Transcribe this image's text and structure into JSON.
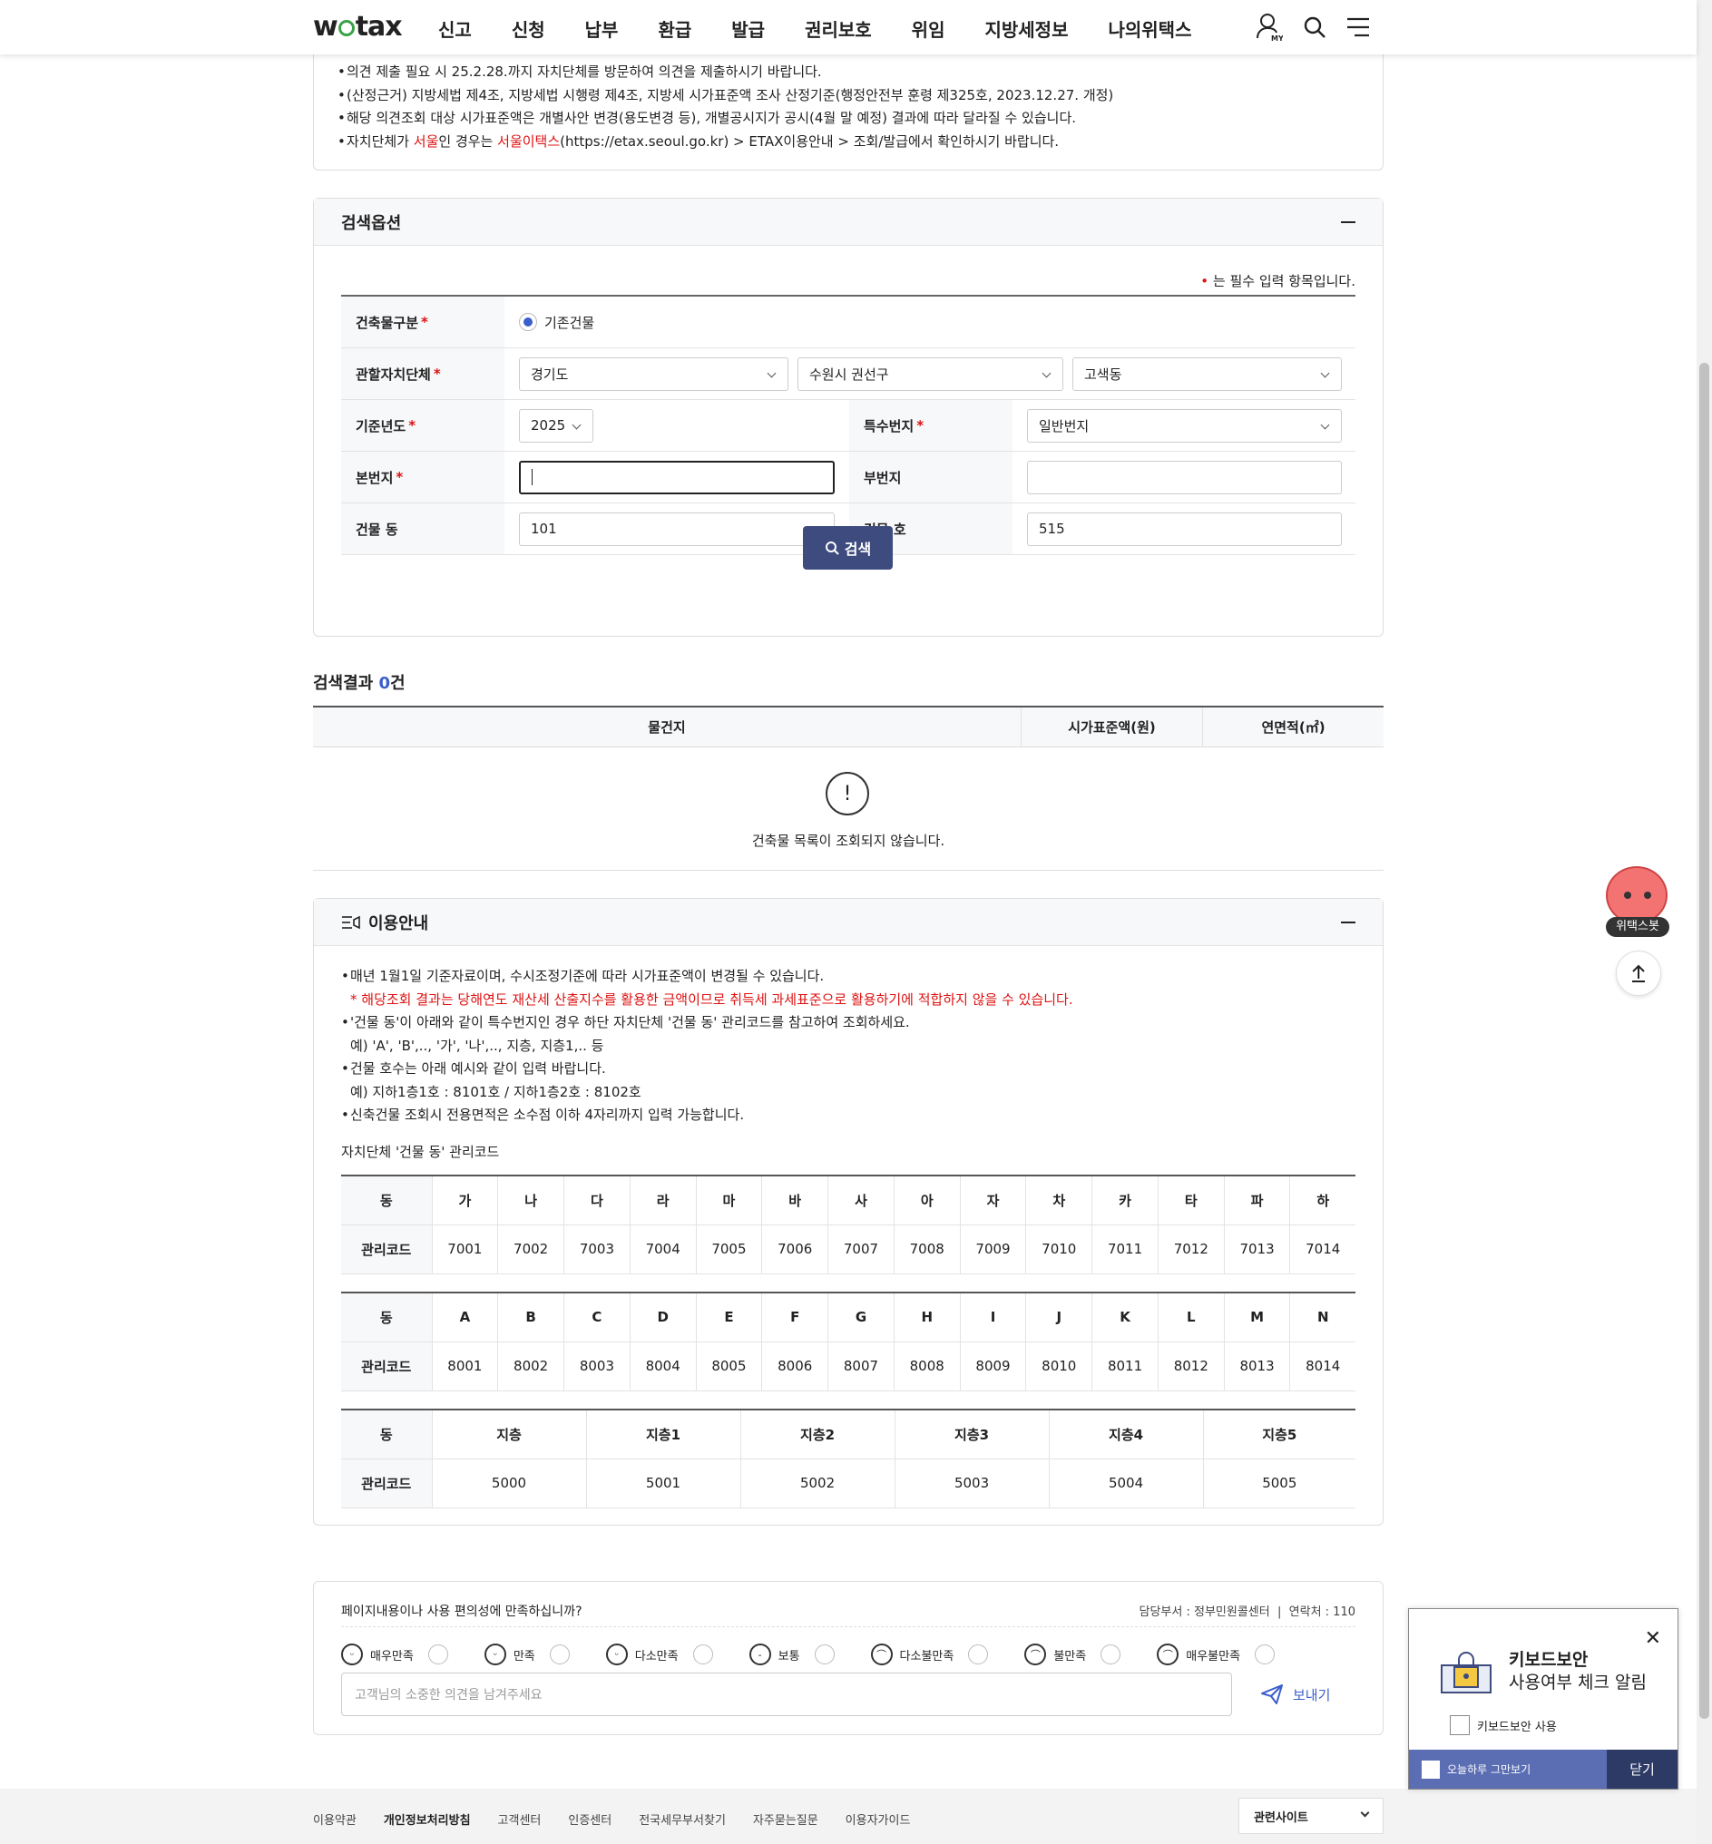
{
  "header": {
    "logo": "wetax",
    "nav": [
      "신고",
      "신청",
      "납부",
      "환급",
      "발급",
      "권리보호",
      "위임",
      "지방세정보",
      "나의위택스"
    ],
    "my_label": "MY"
  },
  "notice": {
    "items": [
      {
        "text": "의견 제출 필요 시 25.2.28.까지 자치단체를 방문하여 의견을 제출하시기 바랍니다."
      },
      {
        "text": "(산정근거) 지방세법 제4조, 지방세법 시행령 제4조, 지방세 시가표준액 조사 산정기준(행정안전부 훈령 제325호, 2023.12.27. 개정)"
      },
      {
        "text": "해당 의견조회 대상 시가표준액은 개별사안 변경(용도변경 등), 개별공시지가 공시(4월 말 예정) 결과에 따라 달라질 수 있습니다."
      }
    ],
    "last_prefix": "자치단체가 ",
    "last_seoul": "서울",
    "last_mid": "인 경우는 ",
    "last_etax": "서울이택스",
    "last_suffix": "(https://etax.seoul.go.kr) > ETAX이용안내 > 조회/발급에서 확인하시기 바랍니다."
  },
  "search": {
    "title": "검색옵션",
    "req_note": "는 필수 입력 항목입니다.",
    "req_mark": "•",
    "building_type_label": "건축물구분",
    "building_type_value": "기존건물",
    "region_label": "관할자치단체",
    "region1": "경기도",
    "region2": "수원시 권선구",
    "region3": "고색동",
    "year_label": "기준년도",
    "year_value": "2025",
    "special_label": "특수번지",
    "special_value": "일반번지",
    "main_no_label": "본번지",
    "main_no_value": "",
    "sub_no_label": "부번지",
    "sub_no_value": "",
    "dong_label": "건물 동",
    "dong_value": "101",
    "ho_label": "건물 호",
    "ho_value": "515",
    "button": "검색",
    "star": "*"
  },
  "results": {
    "title": "검색결과 ",
    "count": "0",
    "unit": "건",
    "columns": [
      "물건지",
      "시가표준액(원)",
      "연면적(㎡)"
    ],
    "empty_icon": "!",
    "empty_text": "건축물 목록이 조회되지 않습니다."
  },
  "guide": {
    "title": "이용안내",
    "l1": "매년 1월1일 기준자료이며, 수시조정기준에 따라 시가표준액이 변경될 수 있습니다.",
    "l1_note": "* 해당조회 결과는 당해연도 재산세 산출지수를 활용한 금액이므로 취득세 과세표준으로 활용하기에 적합하지 않을 수 있습니다.",
    "l2": "'건물 동'이 아래와 같이 특수번지인 경우 하단 자치단체 '건물 동' 관리코드를 참고하여 조회하세요.",
    "l2_ex": "예) 'A', 'B',.., '가', '나',.., 지층, 지층1,.. 등",
    "l3": "건물 호수는 아래 예시와 같이 입력 바랍니다.",
    "l3_ex": "예) 지하1층1호 : 8101호 / 지하1층2호 : 8102호",
    "l4": "신축건물 조회시 전용면적은 소수점 이하 4자리까지 입력 가능합니다.",
    "code_title": "자치단체 '건물 동' 관리코드",
    "row_dong": "동",
    "row_code": "관리코드",
    "t1_dong": [
      "가",
      "나",
      "다",
      "라",
      "마",
      "바",
      "사",
      "아",
      "자",
      "차",
      "카",
      "타",
      "파",
      "하"
    ],
    "t1_code": [
      "7001",
      "7002",
      "7003",
      "7004",
      "7005",
      "7006",
      "7007",
      "7008",
      "7009",
      "7010",
      "7011",
      "7012",
      "7013",
      "7014"
    ],
    "t2_dong": [
      "A",
      "B",
      "C",
      "D",
      "E",
      "F",
      "G",
      "H",
      "I",
      "J",
      "K",
      "L",
      "M",
      "N"
    ],
    "t2_code": [
      "8001",
      "8002",
      "8003",
      "8004",
      "8005",
      "8006",
      "8007",
      "8008",
      "8009",
      "8010",
      "8011",
      "8012",
      "8013",
      "8014"
    ],
    "t3_dong": [
      "지층",
      "지층1",
      "지층2",
      "지층3",
      "지층4",
      "지층5"
    ],
    "t3_code": [
      "5000",
      "5001",
      "5002",
      "5003",
      "5004",
      "5005"
    ]
  },
  "survey": {
    "question": "페이지내용이나 사용 편의성에 만족하십니까?",
    "dept": "담당부서 : 정부민원콜센터",
    "contact": "연락처 : 110",
    "options": [
      "매우만족",
      "만족",
      "다소만족",
      "보통",
      "다소불만족",
      "불만족",
      "매우불만족"
    ],
    "placeholder": "고객님의 소중한 의견을 남겨주세요",
    "send": "보내기"
  },
  "footer": {
    "links": [
      "이용약관",
      "개인정보처리방침",
      "고객센터",
      "인증센터",
      "전국세무부서찾기",
      "자주묻는질문",
      "이용자가이드"
    ],
    "related": "관련사이트"
  },
  "popup": {
    "title1": "키보드보안",
    "title2": "사용여부 체크 알림",
    "checkbox": "키보드보안 사용",
    "today": "오늘하루 그만보기",
    "close": "닫기"
  },
  "bot": {
    "label": "위택스봇"
  }
}
